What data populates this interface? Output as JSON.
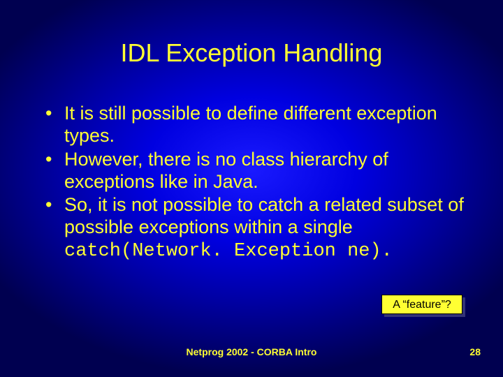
{
  "title": "IDL Exception Handling",
  "bullets": {
    "b1": "It is still possible to define different exception types.",
    "b2": "However, there is no class hierarchy of exceptions like in Java.",
    "b3_pre": "So, it is not possible to catch a related subset of possible exceptions within a single ",
    "b3_code": "catch(Network. Exception ne).",
    "b3_post": ""
  },
  "callout": "A “feature”?",
  "footer_center": "Netprog 2002  -  CORBA Intro",
  "page_number": "28"
}
